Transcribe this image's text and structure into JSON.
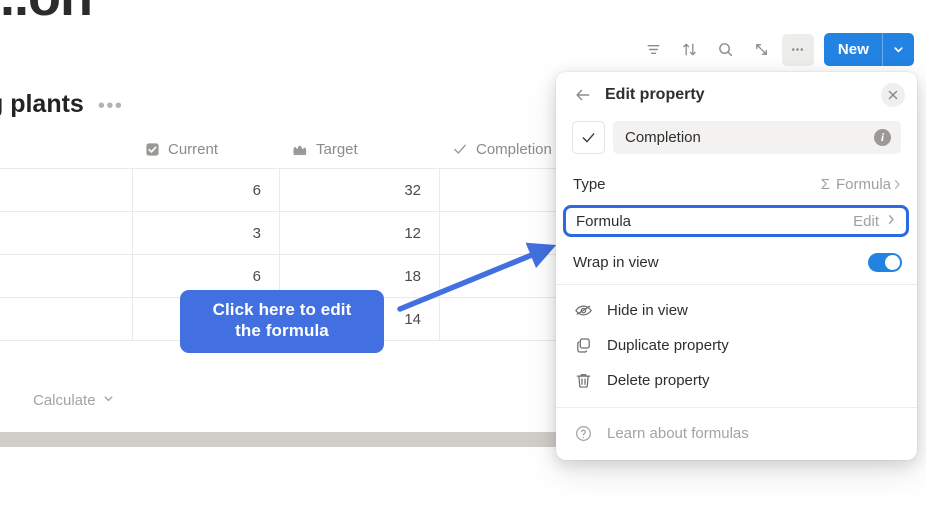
{
  "page": {
    "heading_clipped": "...on",
    "database_title": "g plants",
    "database_menu_icon": "ellipsis-icon"
  },
  "toolbar": {
    "items": [
      {
        "name": "filter-icon",
        "label": "Filter"
      },
      {
        "name": "sort-icon",
        "label": "Sort"
      },
      {
        "name": "search-icon",
        "label": "Search"
      },
      {
        "name": "expand-icon",
        "label": "Expand"
      },
      {
        "name": "more-options-icon",
        "label": "More options"
      }
    ],
    "new_label": "New",
    "new_chevron": "chevron-down-icon",
    "accent_blue": "#2383e2"
  },
  "table": {
    "columns": [
      {
        "label": "",
        "icon": ""
      },
      {
        "label": "Current",
        "icon": "checkbox-icon"
      },
      {
        "label": "Target",
        "icon": "crown-icon"
      },
      {
        "label": "Completion",
        "icon": "check-icon"
      }
    ],
    "rows": [
      {
        "current": "6",
        "target": "32",
        "completion": ""
      },
      {
        "current": "3",
        "target": "12",
        "completion": ""
      },
      {
        "current": "6",
        "target": "18",
        "completion": ""
      },
      {
        "current": "",
        "target": "14",
        "completion": ""
      }
    ],
    "calculate_label": "Calculate",
    "calculate_chevron": "chevron-down-icon"
  },
  "annotation": {
    "callout_line1": "Click here to edit",
    "callout_line2": "the formula",
    "color": "#4270e0",
    "arrow": "arrow-pointing-to-formula-row"
  },
  "panel": {
    "back_icon": "arrow-left-icon",
    "title": "Edit property",
    "close_icon": "close-icon",
    "name_type_icon": "check-icon",
    "name_value": "Completion",
    "name_placeholder": "Property name",
    "info_icon": "info-icon",
    "type_row": {
      "key": "Type",
      "value": "Formula",
      "value_icon": "sigma-icon",
      "chevron": "chevron-right-icon"
    },
    "formula_row": {
      "key": "Formula",
      "value": "Edit",
      "chevron": "chevron-right-icon",
      "highlight_color": "#2b6ae2"
    },
    "wrap_row": {
      "key": "Wrap in view",
      "toggle_on": true,
      "toggle_color": "#2383e2"
    },
    "menu_items": [
      {
        "label": "Hide in view",
        "icon": "eye-off-icon",
        "muted": false
      },
      {
        "label": "Duplicate property",
        "icon": "duplicate-icon",
        "muted": false
      },
      {
        "label": "Delete property",
        "icon": "trash-icon",
        "muted": false
      }
    ],
    "footer_item": {
      "label": "Learn about formulas",
      "icon": "question-circle-icon",
      "muted": true
    }
  }
}
